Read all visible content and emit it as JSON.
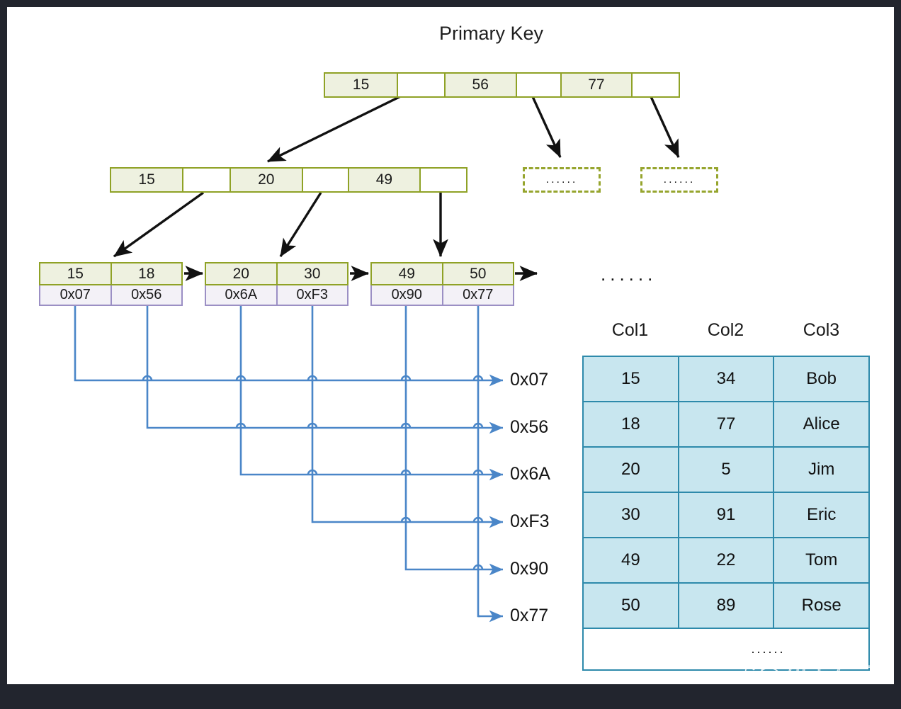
{
  "title": "Primary Key",
  "root_node": {
    "name": "root-index-node",
    "cells": [
      {
        "text": "15",
        "empty": false
      },
      {
        "text": "",
        "empty": true
      },
      {
        "text": "56",
        "empty": false
      },
      {
        "text": "",
        "empty": true
      },
      {
        "text": "77",
        "empty": false
      },
      {
        "text": "",
        "empty": true
      }
    ]
  },
  "mid_node": {
    "name": "internal-index-node",
    "cells": [
      {
        "text": "15",
        "empty": false
      },
      {
        "text": "",
        "empty": true
      },
      {
        "text": "20",
        "empty": false
      },
      {
        "text": "",
        "empty": true
      },
      {
        "text": "49",
        "empty": false
      },
      {
        "text": "",
        "empty": true
      }
    ]
  },
  "placeholder_nodes": [
    {
      "text": "......"
    },
    {
      "text": "......"
    }
  ],
  "leaf_nodes": [
    {
      "keys": [
        "15",
        "18"
      ],
      "addresses": [
        "0x07",
        "0x56"
      ]
    },
    {
      "keys": [
        "20",
        "30"
      ],
      "addresses": [
        "0x6A",
        "0xF3"
      ]
    },
    {
      "keys": [
        "49",
        "50"
      ],
      "addresses": [
        "0x90",
        "0x77"
      ]
    }
  ],
  "leaf_chain_ellipsis": "......",
  "address_labels": [
    "0x07",
    "0x56",
    "0x6A",
    "0xF3",
    "0x90",
    "0x77"
  ],
  "table": {
    "headers": [
      "Col1",
      "Col2",
      "Col3"
    ],
    "rows": [
      [
        "15",
        "34",
        "Bob"
      ],
      [
        "18",
        "77",
        "Alice"
      ],
      [
        "20",
        "5",
        "Jim"
      ],
      [
        "30",
        "91",
        "Eric"
      ],
      [
        "49",
        "22",
        "Tom"
      ],
      [
        "50",
        "89",
        "Rose"
      ]
    ],
    "ellipsis_row": "......"
  },
  "watermark": {
    "text": "码上有云",
    "icon": "wechat-icon"
  },
  "colors": {
    "index_border": "#8fa226",
    "index_fill": "#eef1e0",
    "address_border": "#9b8fc4",
    "address_fill": "#f3f1f7",
    "table_border": "#2e8aab",
    "table_fill": "#c8e6ef",
    "pointer_line": "#4a86c8",
    "frame": "#22252e"
  }
}
